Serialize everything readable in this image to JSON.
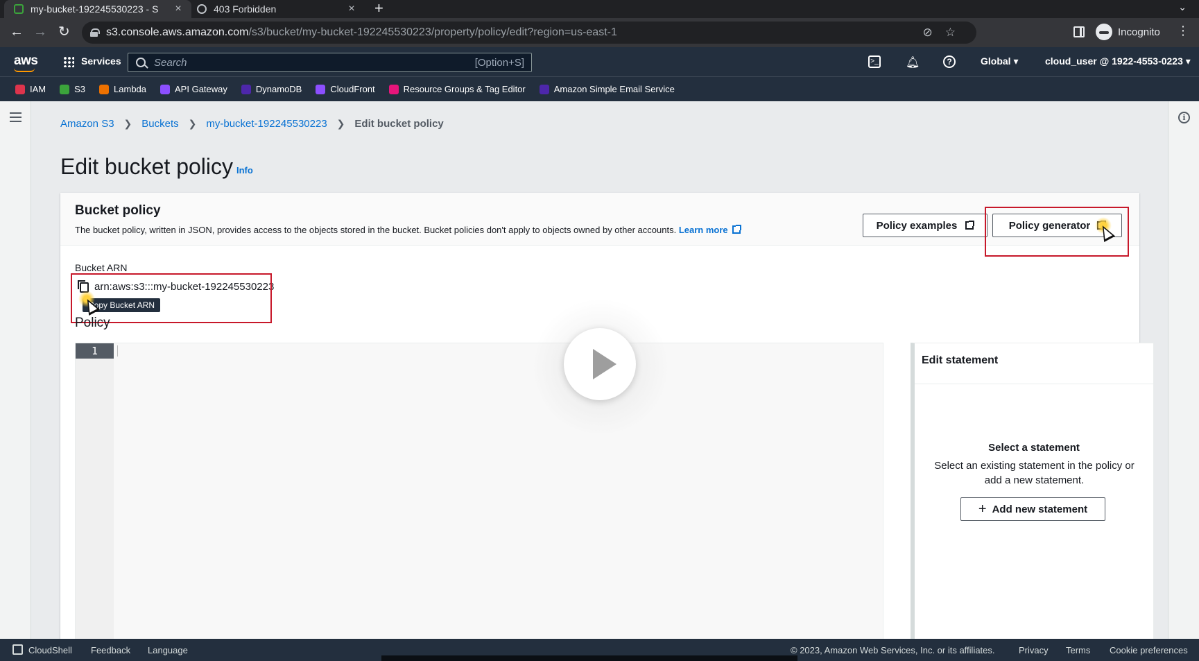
{
  "browser": {
    "tabs": [
      {
        "title": "my-bucket-192245530223 - S",
        "active": true
      },
      {
        "title": "403 Forbidden",
        "active": false
      }
    ],
    "url_host": "s3.console.aws.amazon.com",
    "url_path": "/s3/bucket/my-bucket-192245530223/property/policy/edit?region=us-east-1",
    "profile": "Incognito"
  },
  "aws_header": {
    "logo": "aws",
    "services": "Services",
    "search_placeholder": "Search",
    "search_shortcut": "[Option+S]",
    "region": "Global",
    "account": "cloud_user @ 1922-4553-0223"
  },
  "favorites": [
    {
      "label": "IAM",
      "color": "#dd344c"
    },
    {
      "label": "S3",
      "color": "#3ba33b"
    },
    {
      "label": "Lambda",
      "color": "#ed7100"
    },
    {
      "label": "API Gateway",
      "color": "#8c4fff"
    },
    {
      "label": "DynamoDB",
      "color": "#4d27aa"
    },
    {
      "label": "CloudFront",
      "color": "#8c4fff"
    },
    {
      "label": "Resource Groups & Tag Editor",
      "color": "#e7157b"
    },
    {
      "label": "Amazon Simple Email Service",
      "color": "#4d27aa"
    }
  ],
  "breadcrumb": {
    "items": [
      "Amazon S3",
      "Buckets",
      "my-bucket-192245530223"
    ],
    "current": "Edit bucket policy"
  },
  "page": {
    "title": "Edit bucket policy",
    "info": "Info"
  },
  "bucket_policy": {
    "title": "Bucket policy",
    "description": "The bucket policy, written in JSON, provides access to the objects stored in the bucket. Bucket policies don't apply to objects owned by other accounts.",
    "learn_more": "Learn more",
    "examples_button": "Policy examples",
    "generator_button": "Policy generator",
    "arn_label": "Bucket ARN",
    "arn_value": "arn:aws:s3:::my-bucket-192245530223",
    "copy_tooltip": "Copy Bucket ARN",
    "policy_label": "Policy",
    "editor_line": "1"
  },
  "statement_panel": {
    "title": "Edit statement",
    "empty_title": "Select a statement",
    "empty_desc": "Select an existing statement in the policy or add a new statement.",
    "add_button": "Add new statement"
  },
  "footer": {
    "cloudshell": "CloudShell",
    "feedback": "Feedback",
    "language": "Language",
    "copyright": "© 2023, Amazon Web Services, Inc. or its affiliates.",
    "privacy": "Privacy",
    "terms": "Terms",
    "cookies": "Cookie preferences"
  },
  "colors": {
    "aws_nav": "#232f3e",
    "link": "#0972d3",
    "highlight": "#c7182a"
  }
}
